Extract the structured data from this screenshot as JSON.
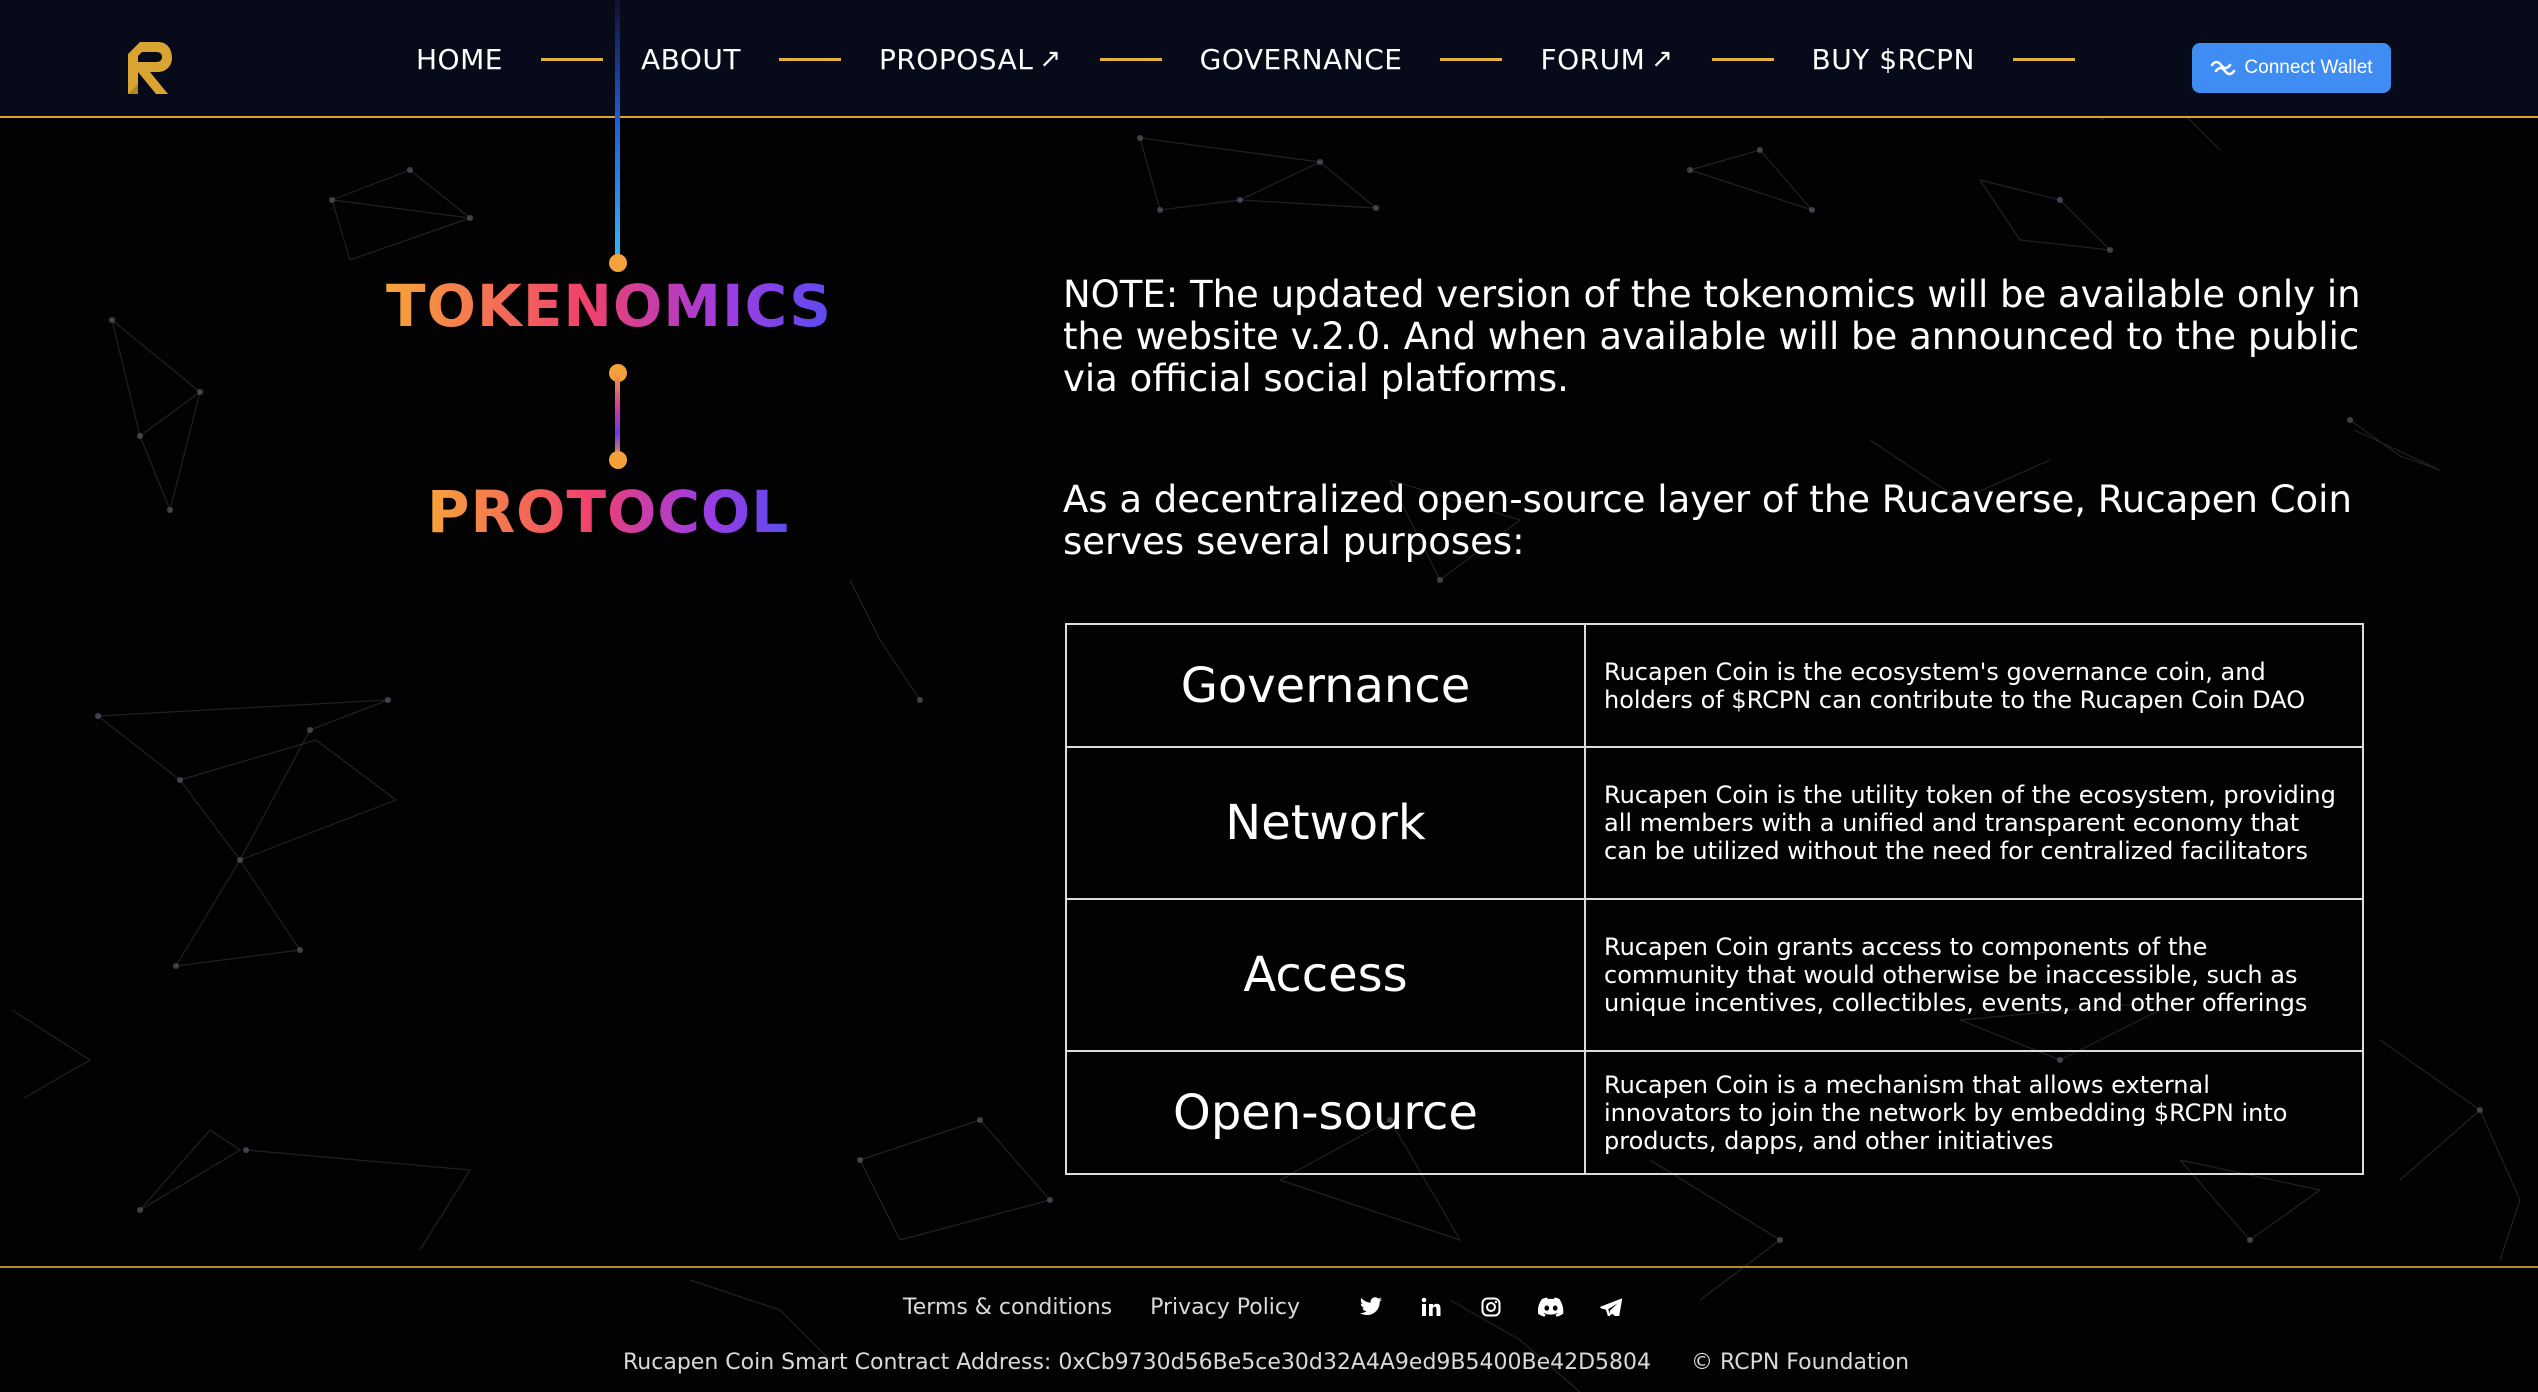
{
  "header": {
    "logo_icon": "rcpn-logo-icon",
    "nav": [
      {
        "label": "HOME",
        "external": false
      },
      {
        "label": "ABOUT",
        "external": false
      },
      {
        "label": "PROPOSAL",
        "external": true
      },
      {
        "label": "GOVERNANCE",
        "external": false
      },
      {
        "label": "FORUM",
        "external": true
      },
      {
        "label": "BUY $RCPN",
        "external": false
      }
    ],
    "external_icon": "↗",
    "connect_wallet_label": "Connect Wallet",
    "connect_wallet_icon": "wallet-wave-icon"
  },
  "left": {
    "title_1": "TOKENOMICS",
    "title_2": "PROTOCOL"
  },
  "main": {
    "note": "NOTE: The updated version of the tokenomics will be available only in the website v.2.0. And when available will be announced to the public via official social platforms.",
    "intro": "As a decentralized open-source layer of the Rucaverse, Rucapen Coin serves several purposes:",
    "purposes": [
      {
        "name": "Governance",
        "description": "Rucapen Coin is the ecosystem's governance coin, and holders of $RCPN can contribute to the Rucapen Coin DAO"
      },
      {
        "name": "Network",
        "description": "Rucapen Coin is the utility token of the ecosystem, providing all members with a unified and transparent economy that can be utilized without the need for centralized facilitators"
      },
      {
        "name": "Access",
        "description": "Rucapen Coin grants access to components of the community that would otherwise be inaccessible, such as unique incentives, collectibles, events, and other offerings"
      },
      {
        "name": "Open-source",
        "description": "Rucapen Coin is a mechanism that allows external innovators to join the network by embedding $RCPN into products, dapps, and other initiatives"
      }
    ]
  },
  "footer": {
    "terms_label": "Terms & conditions",
    "privacy_label": "Privacy Policy",
    "socials": [
      "twitter-icon",
      "linkedin-icon",
      "instagram-icon",
      "discord-icon",
      "telegram-icon"
    ],
    "contract_text": "Rucapen Coin Smart Contract Address: 0xCb9730d56Be5ce30d32A4A9ed9B5400Be42D5804",
    "copyright": "© RCPN Foundation"
  },
  "colors": {
    "accent_gold": "#e2b23c",
    "button_blue": "#3f8df2",
    "background": "#020203"
  }
}
